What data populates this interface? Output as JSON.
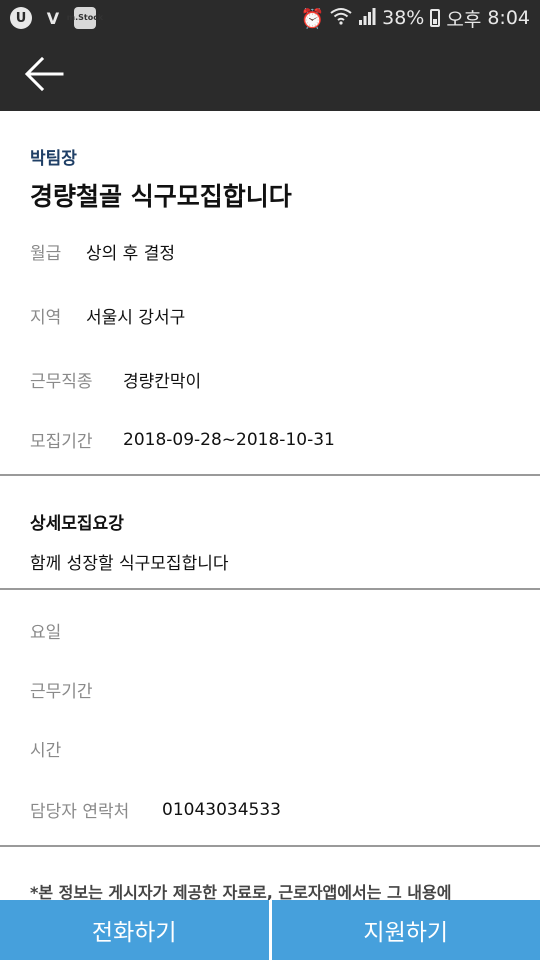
{
  "status_bar": {
    "battery": "38%",
    "ampm": "오후",
    "time": "8:04",
    "stock_icon_label": "m.Stock"
  },
  "job": {
    "company": "박팀장",
    "title": "경량철골 식구모집합니다",
    "fields": [
      {
        "label": "월급",
        "value": "상의 후 결정"
      },
      {
        "label": "지역",
        "value": "서울시 강서구"
      },
      {
        "label": "근무직종",
        "value": "경량칸막이"
      },
      {
        "label": "모집기간",
        "value": "2018-09-28~2018-10-31"
      }
    ]
  },
  "details": {
    "title": "상세모집요강",
    "body": "함께 성장할 식구모집합니다"
  },
  "extra": [
    {
      "label": "요일",
      "value": ""
    },
    {
      "label": "근무기간",
      "value": ""
    },
    {
      "label": "시간",
      "value": ""
    },
    {
      "label": "담당자 연락처",
      "value": "01043034533"
    }
  ],
  "notice": "*본 정보는 게시자가 제공한 자료로, 근로자앱에서는 그 내용에",
  "actions": {
    "call": "전화하기",
    "apply": "지원하기"
  },
  "colors": {
    "header": "#2b2b2b",
    "company": "#1f3f66",
    "button": "#46a0dc"
  }
}
